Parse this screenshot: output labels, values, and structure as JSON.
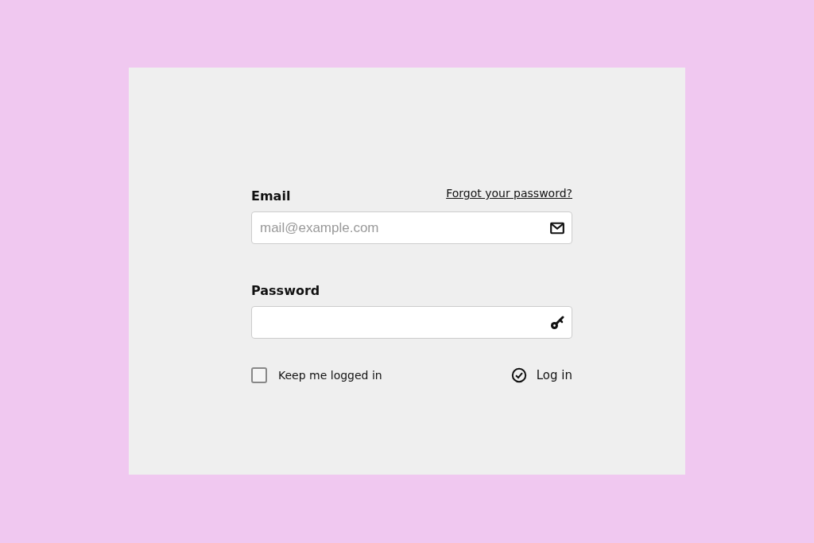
{
  "email": {
    "label": "Email",
    "placeholder": "mail@example.com"
  },
  "forgot_link": "Forgot your password?",
  "password": {
    "label": "Password"
  },
  "keep_logged_in": {
    "label": "Keep me logged in",
    "checked": false
  },
  "login_button": "Log in"
}
